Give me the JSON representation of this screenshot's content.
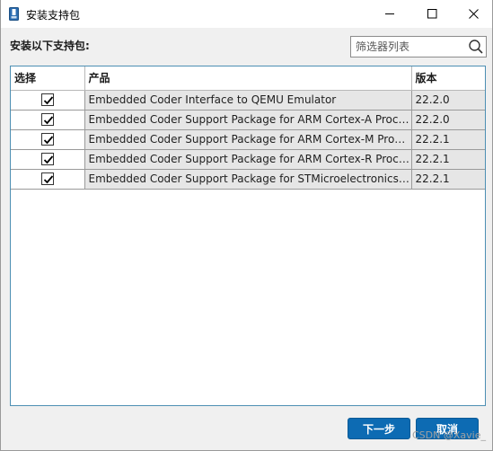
{
  "window": {
    "title": "安装支持包"
  },
  "main": {
    "heading": "安装以下支持包:",
    "filter_placeholder": "筛选器列表"
  },
  "table": {
    "columns": [
      "选择",
      "产品",
      "版本"
    ],
    "rows": [
      {
        "checked": true,
        "product": "Embedded Coder Interface to QEMU Emulator",
        "version": "22.2.0"
      },
      {
        "checked": true,
        "product": "Embedded Coder Support Package for ARM Cortex-A Processors",
        "version": "22.2.0"
      },
      {
        "checked": true,
        "product": "Embedded Coder Support Package for ARM Cortex-M Processors",
        "version": "22.2.1"
      },
      {
        "checked": true,
        "product": "Embedded Coder Support Package for ARM Cortex-R Processors",
        "version": "22.2.1"
      },
      {
        "checked": true,
        "product": "Embedded Coder Support Package for STMicroelectronics STM...",
        "version": "22.2.1"
      }
    ]
  },
  "footer": {
    "next_label": "下一步",
    "cancel_label": "取消",
    "watermark": "CSDN @Xavie_"
  },
  "colors": {
    "accent": "#0d6bb3",
    "table_border": "#4d8fb3",
    "row_fill": "#e6e6e6"
  },
  "icons": {
    "app": "matlab-package-icon",
    "search": "search-icon",
    "minimize": "minimize-icon",
    "maximize": "maximize-icon",
    "close": "close-icon",
    "check": "checkmark-icon"
  }
}
